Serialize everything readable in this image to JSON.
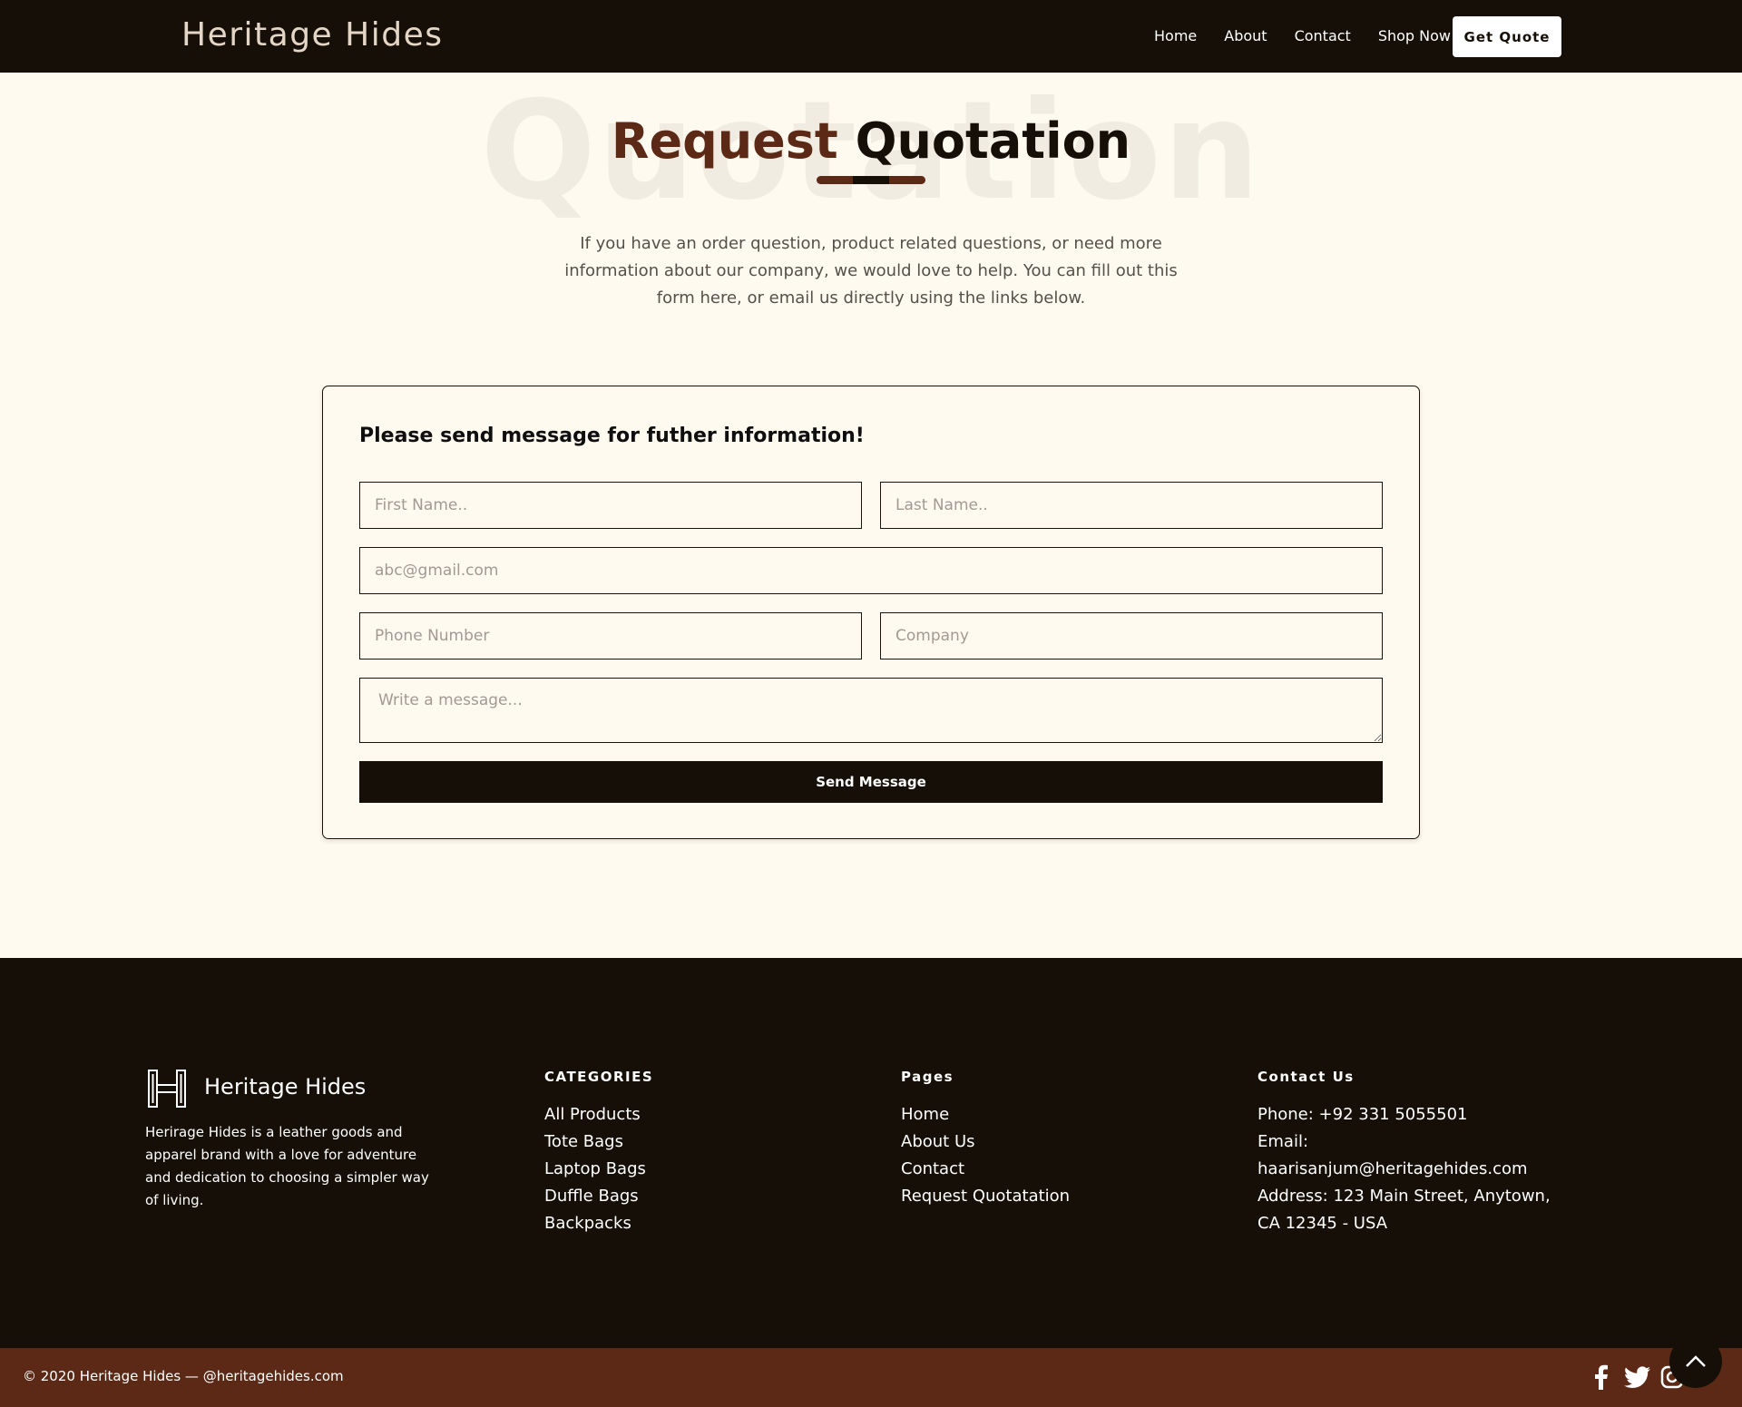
{
  "header": {
    "brand": "Heritage Hides",
    "nav": [
      "Home",
      "About",
      "Contact",
      "Shop Now"
    ],
    "cta": "Get Quote"
  },
  "hero": {
    "bg_word": "Quotation",
    "title_part1": "Request",
    "title_part2": "Quotation",
    "intro": "If you have an order question, product related questions, or need more information about our company, we would love to help. You can fill out this form here, or email us directly using the links below."
  },
  "form": {
    "heading": "Please send message for futher information!",
    "first_name_placeholder": "First Name..",
    "last_name_placeholder": "Last Name..",
    "email_placeholder": "abc@gmail.com",
    "phone_placeholder": "Phone Number",
    "company_placeholder": "Company",
    "message_placeholder": "Write a message...",
    "submit_label": "Send Message"
  },
  "footer": {
    "brand": "Heritage Hides",
    "about": "Herirage Hides is a leather goods and apparel brand with a love for adventure and dedication to choosing a simpler way of living.",
    "categories": {
      "heading": "CATEGORIES",
      "items": [
        "All Products",
        "Tote Bags",
        "Laptop Bags",
        "Duffle Bags",
        "Backpacks"
      ]
    },
    "pages": {
      "heading": "Pages",
      "items": [
        "Home",
        "About Us",
        "Contact",
        "Request Quotatation"
      ]
    },
    "contact": {
      "heading": "Contact Us",
      "phone": "Phone: +92 331 5055501",
      "email": "Email: haarisanjum@heritagehides.com",
      "address": "Address: 123 Main Street, Anytown, CA 12345 - USA"
    }
  },
  "bottom_bar": {
    "copyright": "© 2020 Heritage Hides — @heritagehides.com",
    "social_icons": [
      "facebook-icon",
      "twitter-icon",
      "instagram-icon"
    ]
  },
  "colors": {
    "dark": "#160f07",
    "brown": "#5b2915",
    "cream": "#fefaef"
  }
}
